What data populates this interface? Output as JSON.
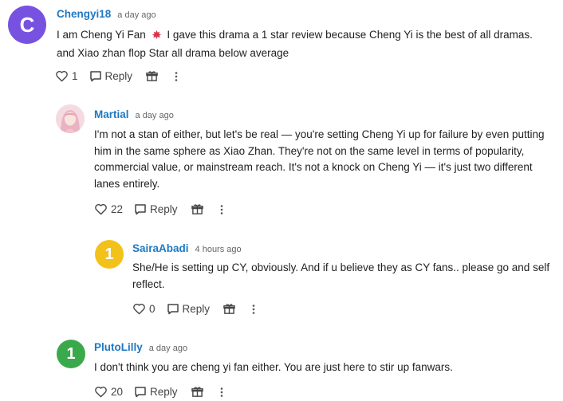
{
  "comments": [
    {
      "username": "Chengyi18",
      "avatar_letter": "C",
      "time": "a day ago",
      "text_part1": "I am Cheng Yi Fan",
      "text_part2": "I gave this drama a 1 star review because Cheng Yi is the best of all dramas. and Xiao zhan flop Star all drama below average",
      "likes": "1",
      "reply_label": "Reply"
    },
    {
      "username": "Martial",
      "time": "a day ago",
      "text": "I'm not a stan of either, but let's be real — you're setting Cheng Yi up for failure by even putting him in the same sphere as Xiao Zhan. They're not on the same level in terms of popularity, commercial value, or mainstream reach. It's not a knock on Cheng Yi — it's just two different lanes entirely.",
      "likes": "22",
      "reply_label": "Reply"
    },
    {
      "username": "SairaAbadi",
      "avatar_letter": "1",
      "time": "4 hours ago",
      "text": "She/He is setting up CY, obviously. And if u believe they as CY fans.. please go and self reflect.",
      "likes": "0",
      "reply_label": "Reply"
    },
    {
      "username": "PlutoLilly",
      "avatar_letter": "1",
      "time": "a day ago",
      "text": "I don't think you are cheng yi fan either. You are just here to stir up fanwars.",
      "likes": "20",
      "reply_label": "Reply"
    }
  ],
  "colors": {
    "username": "#1e78c2",
    "avatar_purple": "#7752e0",
    "avatar_yellow": "#f3c21a",
    "avatar_green": "#3aa94b"
  },
  "icons": [
    "heart-icon",
    "reply-bubble-icon",
    "gift-icon",
    "more-vertical-icon",
    "maple-leaf-emoji-icon"
  ]
}
